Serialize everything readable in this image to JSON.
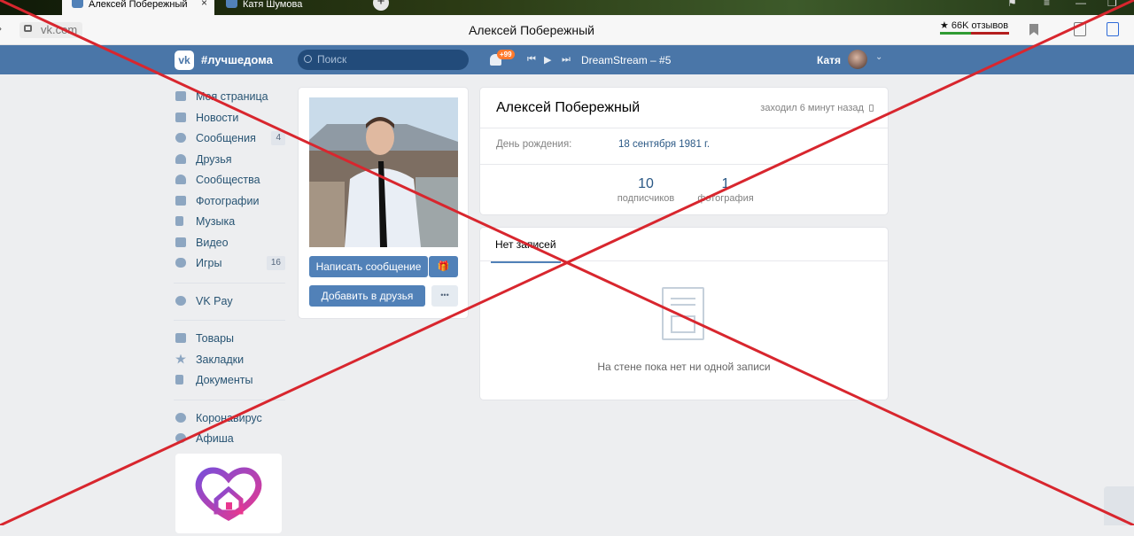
{
  "browser": {
    "tabs": [
      {
        "label": "Алексей Побережный",
        "active": true
      },
      {
        "label": "Катя Шумова",
        "active": false
      }
    ],
    "url": "vk.com",
    "page_title": "Алексей Побережный",
    "reviews_label": "★ 66K отзывов",
    "new_tab": "+"
  },
  "vk_header": {
    "hashtag": "#лучшедома",
    "search_placeholder": "Поиск",
    "notifications_badge": "+99",
    "track": "DreamStream – #5",
    "user_name": "Катя"
  },
  "sidebar": {
    "items": [
      {
        "label": "Моя страница",
        "icon": "home-icon"
      },
      {
        "label": "Новости",
        "icon": "news-icon"
      },
      {
        "label": "Сообщения",
        "icon": "messages-icon",
        "count": "4"
      },
      {
        "label": "Друзья",
        "icon": "friends-icon"
      },
      {
        "label": "Сообщества",
        "icon": "communities-icon"
      },
      {
        "label": "Фотографии",
        "icon": "camera-icon"
      },
      {
        "label": "Музыка",
        "icon": "music-icon"
      },
      {
        "label": "Видео",
        "icon": "video-icon"
      },
      {
        "label": "Игры",
        "icon": "gamepad-icon",
        "count": "16"
      }
    ],
    "pay": {
      "label": "VK Pay",
      "icon": "vkpay-icon"
    },
    "items2": [
      {
        "label": "Товары",
        "icon": "bag-icon"
      },
      {
        "label": "Закладки",
        "icon": "star-icon"
      },
      {
        "label": "Документы",
        "icon": "document-icon"
      }
    ],
    "items3": [
      {
        "label": "Коронавирус",
        "icon": "virus-icon"
      },
      {
        "label": "Афиша",
        "icon": "play-icon"
      }
    ]
  },
  "profile": {
    "send_message": "Написать сообщение",
    "add_friend": "Добавить в друзья",
    "more": "•••",
    "name": "Алексей Побережный",
    "last_seen": "заходил 6 минут назад",
    "birthday_label": "День рождения:",
    "birthday_value": "18 сентября 1981 г.",
    "stats": [
      {
        "value": "10",
        "label": "подписчиков"
      },
      {
        "value": "1",
        "label": "фотография"
      }
    ]
  },
  "wall": {
    "tab": "Нет записей",
    "empty_text": "На стене пока нет ни одной записи"
  },
  "colors": {
    "vk_blue": "#4a76a8",
    "button_blue": "#5181b8",
    "cross_red": "#d8262e"
  }
}
